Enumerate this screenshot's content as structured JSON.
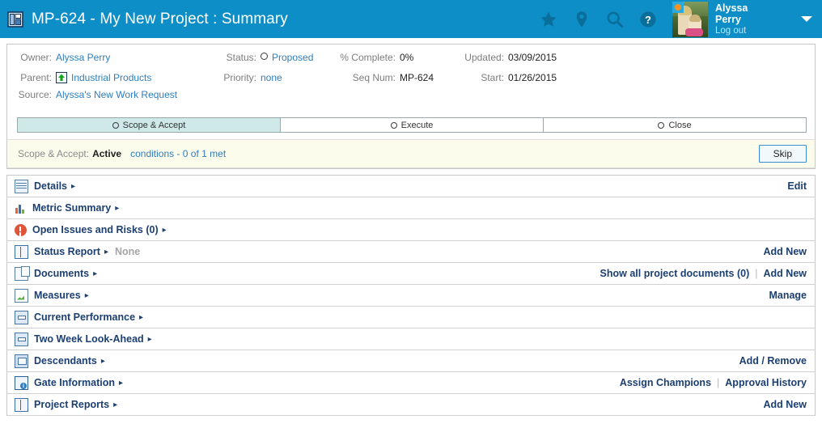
{
  "header": {
    "app_icon": "project-grid-icon",
    "title": "MP-624 - My New Project : Summary",
    "icons": [
      {
        "name": "favorite-star-icon",
        "glyph": "star"
      },
      {
        "name": "location-pin-icon",
        "glyph": "pin"
      },
      {
        "name": "search-icon",
        "glyph": "search"
      },
      {
        "name": "help-icon",
        "glyph": "question"
      }
    ],
    "user": {
      "name": "Alyssa Perry",
      "name_line1": "Alyssa",
      "name_line2": "Perry",
      "logout": "Log out",
      "avatar": "user-avatar-photo"
    },
    "background_color": "#0d8ec7"
  },
  "summary": {
    "fields": [
      {
        "label": "Owner:",
        "value": "Alyssa Perry",
        "type": "link"
      },
      {
        "label": "Status:",
        "value": "Proposed",
        "type": "radio-link"
      },
      {
        "label": "% Complete:",
        "value": "0%",
        "type": "text"
      },
      {
        "label": "Updated:",
        "value": "03/09/2015",
        "type": "text"
      },
      {
        "label": "Parent:",
        "value": "Industrial Products",
        "type": "icon-link"
      },
      {
        "label": "Priority:",
        "value": "none",
        "type": "link"
      },
      {
        "label": "Seq Num:",
        "value": "MP-624",
        "type": "text"
      },
      {
        "label": "Start:",
        "value": "01/26/2015",
        "type": "text"
      },
      {
        "label": "Source:",
        "value": "Alyssa's New Work Request",
        "type": "link"
      }
    ]
  },
  "stages": [
    {
      "label": "Scope & Accept",
      "active": true
    },
    {
      "label": "Execute",
      "active": false
    },
    {
      "label": "Close",
      "active": false
    }
  ],
  "condition_bar": {
    "stage_label": "Scope & Accept:",
    "state": "Active",
    "conditions_link": "conditions - 0 of 1 met",
    "skip_label": "Skip"
  },
  "sections": [
    {
      "label": "Details",
      "icon": "details-grid-icon",
      "arrow": "▸",
      "muted": "",
      "actions": [
        "Edit"
      ]
    },
    {
      "label": "Metric Summary",
      "icon": "metric-bars-icon",
      "arrow": "▸",
      "muted": "",
      "actions": []
    },
    {
      "label": "Open Issues and Risks (0)",
      "icon": "alert-icon",
      "arrow": "▸",
      "muted": "",
      "actions": []
    },
    {
      "label": "Status Report",
      "icon": "status-report-book-icon",
      "arrow": "▸",
      "muted": "None",
      "actions": [
        "Add New"
      ]
    },
    {
      "label": "Documents",
      "icon": "documents-icon",
      "arrow": "▸",
      "muted": "",
      "actions": [
        "Show all project documents (0)",
        "Add New"
      ]
    },
    {
      "label": "Measures",
      "icon": "measures-chart-icon",
      "arrow": "▸",
      "muted": "",
      "actions": [
        "Manage"
      ]
    },
    {
      "label": "Current Performance",
      "icon": "current-performance-table-icon",
      "arrow": "▸",
      "muted": "",
      "actions": []
    },
    {
      "label": "Two Week Look-Ahead",
      "icon": "look-ahead-table-icon",
      "arrow": "▸",
      "muted": "",
      "actions": []
    },
    {
      "label": "Descendants",
      "icon": "descendants-stack-icon",
      "arrow": "▸",
      "muted": "",
      "actions": [
        "Add / Remove"
      ]
    },
    {
      "label": "Gate Information",
      "icon": "gate-info-icon",
      "arrow": "▸",
      "muted": "",
      "actions": [
        "Assign Champions",
        "Approval History"
      ]
    },
    {
      "label": "Project Reports",
      "icon": "project-reports-book-icon",
      "arrow": "▸",
      "muted": "",
      "actions": [
        "Add New"
      ]
    }
  ]
}
